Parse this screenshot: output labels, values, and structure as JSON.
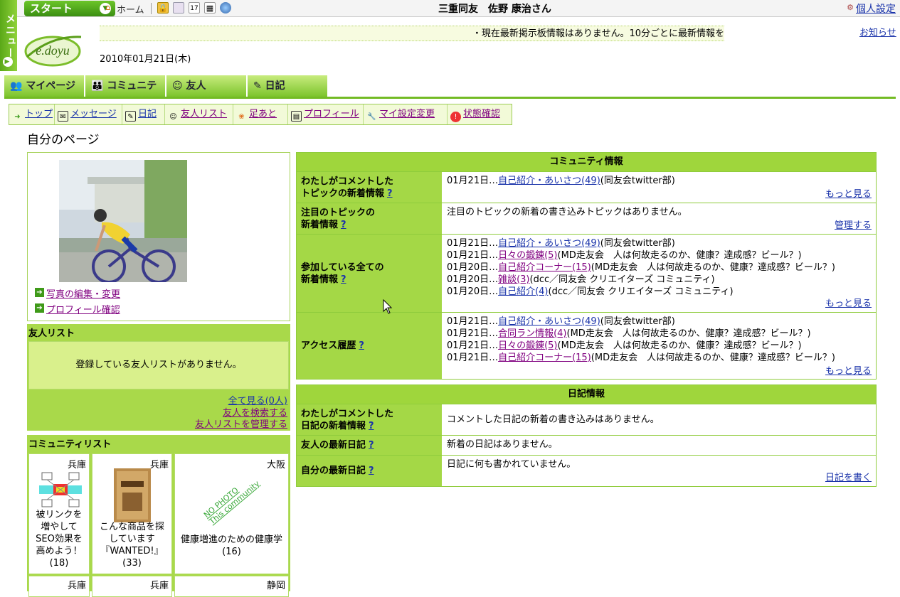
{
  "side_menu": {
    "label": "メニュー"
  },
  "topbar": {
    "start_label": "スタート",
    "home_label": "ホーム",
    "page_title": "三重同友　佐野 康治さん",
    "personal_settings": "個人設定"
  },
  "header": {
    "logo_text": "e.doyu",
    "ticker": "・現在最新掲示板情報はありません。10分ごとに最新情報を",
    "date": "2010年01月21日(木)",
    "notice": "お知らせ"
  },
  "main_tabs": [
    {
      "label": "マイページ",
      "icon": "my-page-icon"
    },
    {
      "label": "コミュニティ",
      "icon": "community-icon"
    },
    {
      "label": "友人",
      "icon": "friend-icon"
    },
    {
      "label": "日記",
      "icon": "diary-icon"
    }
  ],
  "subnav": [
    {
      "label": "トップ",
      "icon": "top-icon"
    },
    {
      "label": "メッセージ",
      "icon": "message-icon"
    },
    {
      "label": "日記",
      "icon": "diary-icon"
    },
    {
      "label": "友人リスト",
      "icon": "friend-list-icon"
    },
    {
      "label": "足あと",
      "icon": "footprint-icon"
    },
    {
      "label": "プロフィール",
      "icon": "profile-icon"
    },
    {
      "label": "マイ設定変更",
      "icon": "settings-icon"
    },
    {
      "label": "状態確認",
      "icon": "status-icon"
    }
  ],
  "page_title": "自分のページ",
  "profile": {
    "edit_photo": "写真の編集・変更",
    "view_profile": "プロフィール確認"
  },
  "friends": {
    "heading": "友人リスト",
    "empty": "登録している友人リストがありません。",
    "view_all": "全て見る(0人)",
    "search": "友人を検索する",
    "manage": "友人リストを管理する"
  },
  "communities": {
    "heading": "コミュニティリスト",
    "items": [
      {
        "pref": "兵庫",
        "name": "被リンクを増やしてSEO効果を高めよう！(18)"
      },
      {
        "pref": "兵庫",
        "name": "こんな商品を探しています『WANTED!』(33)"
      },
      {
        "pref": "大阪",
        "name": "健康増進のための健康学(16)",
        "nophoto1": "NO PHOTO",
        "nophoto2": "This community"
      }
    ],
    "next_row": [
      {
        "pref": "兵庫"
      },
      {
        "pref": "兵庫"
      },
      {
        "pref": "静岡"
      }
    ]
  },
  "community_info": {
    "title": "コミュニティ情報",
    "more": "もっと見る",
    "manage": "管理する",
    "rows": {
      "commented": {
        "label1": "わたしがコメントした",
        "label2": "トピックの新着情報",
        "entries": [
          {
            "date": "01月21日…",
            "link": "自己紹介・あいさつ(49)",
            "rest": "(同友会twitter部)"
          }
        ]
      },
      "featured": {
        "label1": "注目のトピックの",
        "label2": "新着情報",
        "text": "注目のトピックの新着の書き込みトピックはありません。"
      },
      "all": {
        "label1": "参加している全ての",
        "label2": "新着情報",
        "entries": [
          {
            "date": "01月21日…",
            "link": "自己紹介・あいさつ(49)",
            "rest": "(同友会twitter部)"
          },
          {
            "date": "01月21日…",
            "link": "日々の鍛錬(5)",
            "rest": "(MD走友会　人は何故走るのか、健康？達成感？ビール？)"
          },
          {
            "date": "01月20日…",
            "link": "自己紹介コーナー(15)",
            "rest": "(MD走友会　人は何故走るのか、健康？達成感？ビール？)"
          },
          {
            "date": "01月20日…",
            "link": "雑談(3)",
            "rest": "(dcc／同友会 クリエイターズ コミュニティ)"
          },
          {
            "date": "01月20日…",
            "link": "自己紹介(4)",
            "rest": "(dcc／同友会 クリエイターズ コミュニティ)"
          }
        ]
      },
      "history": {
        "label1": "アクセス履歴",
        "entries": [
          {
            "date": "01月21日…",
            "link": "自己紹介・あいさつ(49)",
            "rest": "(同友会twitter部)"
          },
          {
            "date": "01月21日…",
            "link": "合同ラン情報(4)",
            "rest": "(MD走友会　人は何故走るのか、健康？達成感？ビール？)"
          },
          {
            "date": "01月21日…",
            "link": "日々の鍛錬(5)",
            "rest": "(MD走友会　人は何故走るのか、健康？達成感？ビール？)"
          },
          {
            "date": "01月21日…",
            "link": "自己紹介コーナー(15)",
            "rest": "(MD走友会　人は何故走るのか、健康？達成感？ビール？)"
          }
        ]
      }
    }
  },
  "diary_info": {
    "title": "日記情報",
    "rows": {
      "commented": {
        "label1": "わたしがコメントした",
        "label2": "日記の新着情報",
        "text": "コメントした日記の新着の書き込みはありません。"
      },
      "friends": {
        "label1": "友人の最新日記",
        "text": "新着の日記はありません。"
      },
      "mine": {
        "label1": "自分の最新日記",
        "text": "日記に何も書かれていません。",
        "link": "日記を書く"
      }
    }
  },
  "question_mark": "?"
}
